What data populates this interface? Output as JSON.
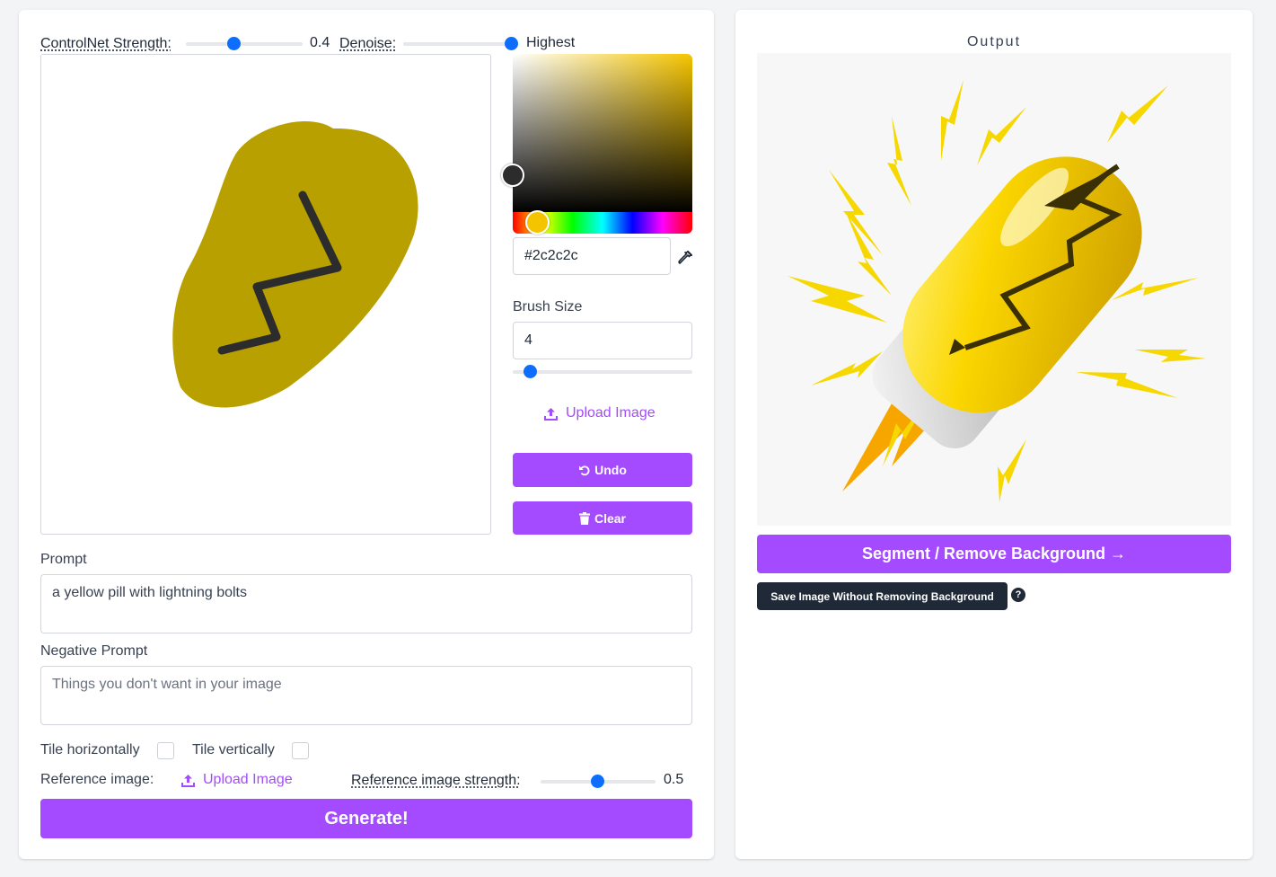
{
  "controls": {
    "controlnet_label": "ControlNet Strength:",
    "controlnet_value": "0.4",
    "controlnet_level": 0.4,
    "denoise_label": "Denoise:",
    "denoise_value": "Highest",
    "denoise_level": 1.0
  },
  "color_picker": {
    "hex_value": "#2c2c2c",
    "eyedropper_icon": "eyedropper-icon",
    "selected_hue": "#f5c400"
  },
  "brush": {
    "label": "Brush Size",
    "value": "4",
    "level": 0.1
  },
  "side_actions": {
    "upload_label": "Upload Image",
    "undo_label": "Undo",
    "clear_label": "Clear"
  },
  "prompt": {
    "label": "Prompt",
    "value": "a yellow pill with lightning bolts"
  },
  "negative_prompt": {
    "label": "Negative Prompt",
    "placeholder": "Things you don't want in your image"
  },
  "tiling": {
    "horizontal_label": "Tile horizontally",
    "vertical_label": "Tile vertically",
    "horizontal_checked": false,
    "vertical_checked": false
  },
  "reference": {
    "label": "Reference image:",
    "upload_label": "Upload Image",
    "strength_label": "Reference image strength:",
    "strength_value": "0.5",
    "strength_level": 0.5
  },
  "generate_label": "Generate!",
  "output": {
    "title": "Output",
    "segment_label": "Segment / Remove Background →",
    "save_label": "Save Image Without Removing Background",
    "help_label": "?"
  },
  "colors": {
    "accent": "#a54bff",
    "slider_thumb": "#0d6efd",
    "sketch_fill": "#b8a000",
    "sketch_stroke": "#2c2c2c",
    "dark_button": "#1f2937"
  }
}
